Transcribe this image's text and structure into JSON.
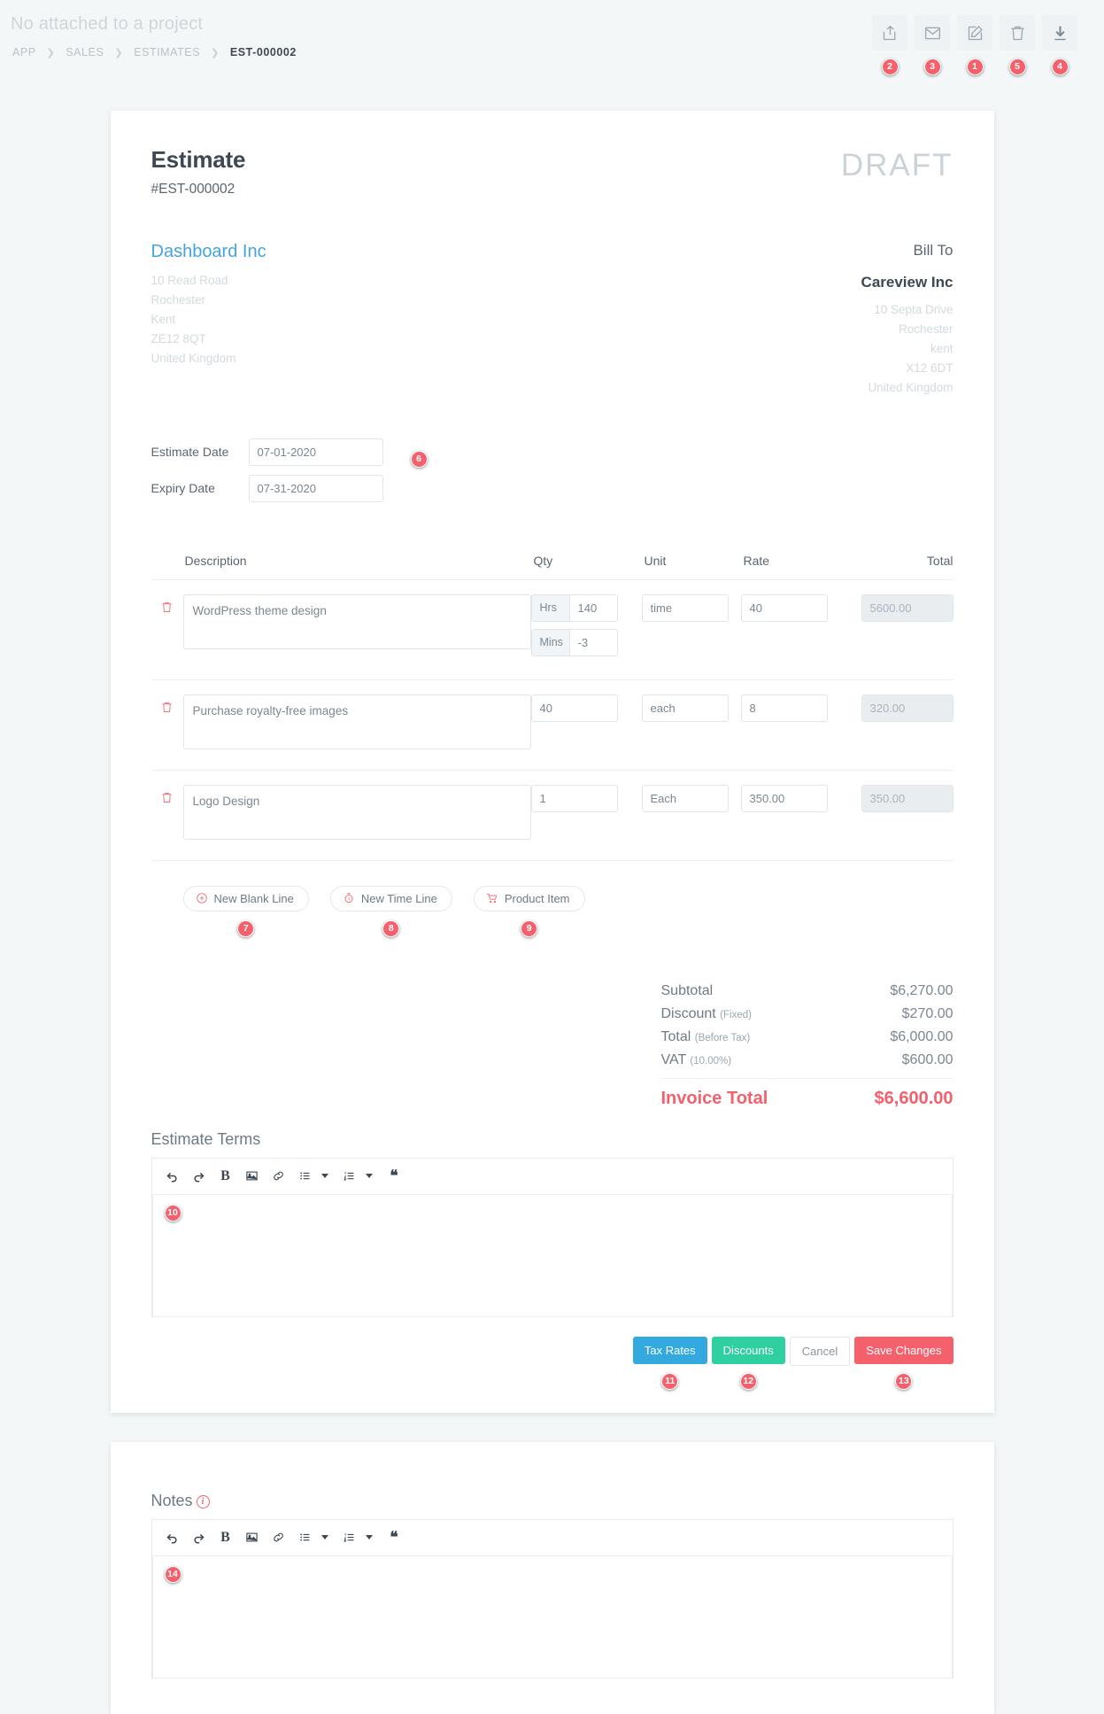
{
  "topbar": {
    "project_note": "No attached to a project",
    "breadcrumb": [
      "APP",
      "SALES",
      "ESTIMATES",
      "EST-000002"
    ],
    "tools": [
      {
        "name": "share-icon",
        "badge": "2"
      },
      {
        "name": "envelope-icon",
        "badge": "3"
      },
      {
        "name": "edit-icon",
        "badge": "1"
      },
      {
        "name": "trash-icon",
        "badge": "5"
      },
      {
        "name": "download-icon",
        "badge": "4"
      }
    ]
  },
  "estimate": {
    "title": "Estimate",
    "number": "#EST-000002",
    "status_watermark": "DRAFT",
    "from": {
      "name": "Dashboard Inc",
      "address": [
        "10 Read Road",
        "Rochester",
        "Kent",
        "ZE12 8QT",
        "United Kingdom"
      ]
    },
    "bill_to": {
      "label": "Bill To",
      "name": "Careview Inc",
      "address": [
        "10 Septa Drive",
        "Rochester",
        "kent",
        "X12 6DT",
        "United Kingdom"
      ]
    },
    "dates": {
      "estimate_date_label": "Estimate Date",
      "estimate_date_value": "07-01-2020",
      "expiry_date_label": "Expiry Date",
      "expiry_date_value": "07-31-2020",
      "badge": "6"
    }
  },
  "items_table": {
    "columns": [
      "Description",
      "Qty",
      "Unit",
      "Rate",
      "Total"
    ],
    "rows": [
      {
        "description": "WordPress theme design",
        "qty_type": "time",
        "hrs_label": "Hrs",
        "hrs_value": "140",
        "mins_label": "Mins",
        "mins_value": "-3",
        "unit": "time",
        "rate": "40",
        "total": "5600.00"
      },
      {
        "description": "Purchase royalty-free images",
        "qty_type": "plain",
        "qty": "40",
        "unit": "each",
        "rate": "8",
        "total": "320.00"
      },
      {
        "description": "Logo Design",
        "qty_type": "plain",
        "qty": "1",
        "unit": "Each",
        "rate": "350.00",
        "total": "350.00"
      }
    ]
  },
  "add_line_buttons": [
    {
      "label": "New Blank Line",
      "icon": "plus-circle-icon",
      "badge": "7"
    },
    {
      "label": "New Time Line",
      "icon": "stopwatch-icon",
      "badge": "8"
    },
    {
      "label": "Product Item",
      "icon": "cart-icon",
      "badge": "9"
    }
  ],
  "totals": {
    "subtotal_label": "Subtotal",
    "subtotal_value": "$6,270.00",
    "discount_label": "Discount",
    "discount_note": "(Fixed)",
    "discount_value": "$270.00",
    "total_label": "Total",
    "total_note": "(Before Tax)",
    "total_value": "$6,000.00",
    "vat_label": "VAT",
    "vat_note": "(10.00%)",
    "vat_value": "$600.00",
    "grand_label": "Invoice Total",
    "grand_value": "$6,600.00"
  },
  "terms": {
    "title": "Estimate Terms",
    "content": "",
    "badge": "10"
  },
  "notes": {
    "title": "Notes",
    "info_icon": "i",
    "content": "",
    "badge": "14"
  },
  "editor_toolbar": [
    {
      "name": "undo-icon",
      "label": ""
    },
    {
      "name": "redo-icon",
      "label": ""
    },
    {
      "name": "bold-icon",
      "label": "B"
    },
    {
      "name": "image-icon",
      "label": ""
    },
    {
      "name": "link-icon",
      "label": ""
    },
    {
      "name": "bullet-list-icon",
      "label": ""
    },
    {
      "name": "numbered-list-icon",
      "label": ""
    },
    {
      "name": "blockquote-icon",
      "label": "“"
    }
  ],
  "footer": {
    "tax_rates_label": "Tax Rates",
    "tax_rates_badge": "11",
    "discounts_label": "Discounts",
    "discounts_badge": "12",
    "cancel_label": "Cancel",
    "save_label": "Save Changes",
    "save_badge": "13"
  },
  "colors": {
    "page_bg": "#f4f7f8",
    "accent_red": "#f4606c",
    "link_blue": "#42a5dd",
    "tax_blue": "#33a9e0",
    "discount_green": "#2ecfa0"
  }
}
